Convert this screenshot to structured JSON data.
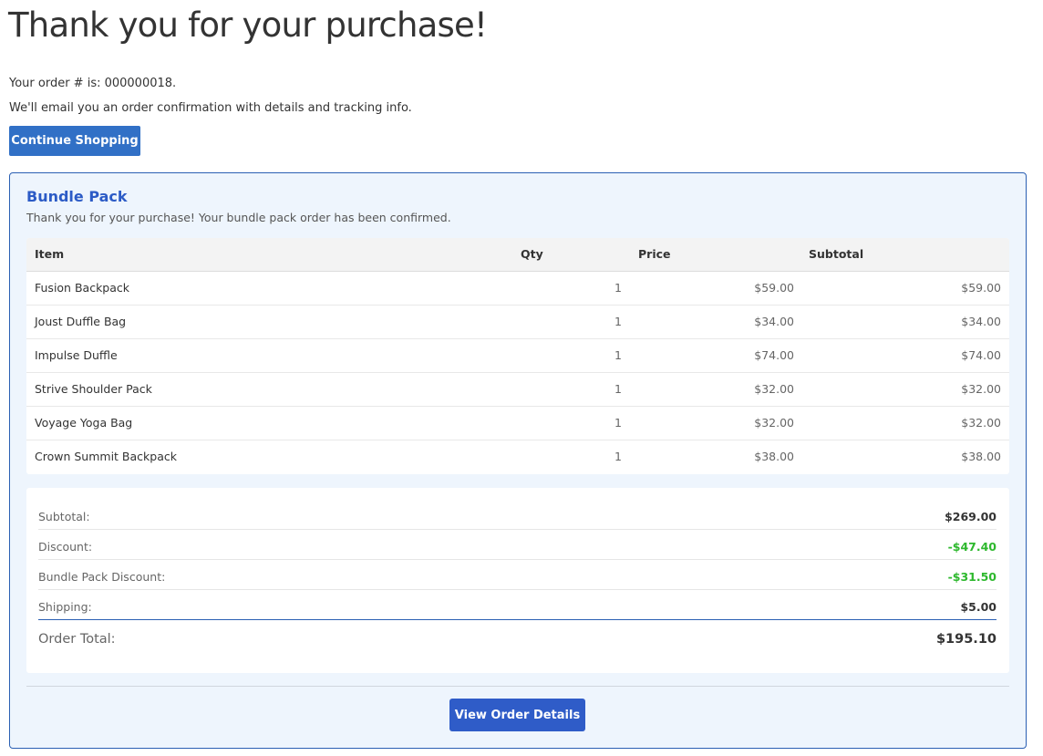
{
  "page": {
    "title": "Thank you for your purchase!",
    "order_line": "Your order # is: 000000018.",
    "email_line": "We'll email you an order confirmation with details and tracking info.",
    "continue_label": "Continue Shopping"
  },
  "bundle": {
    "title": "Bundle Pack",
    "subtitle": "Thank you for your purchase! Your bundle pack order has been confirmed.",
    "columns": [
      "Item",
      "Qty",
      "Price",
      "Subtotal"
    ],
    "items": [
      {
        "name": "Fusion Backpack",
        "qty": "1",
        "price": "$59.00",
        "subtotal": "$59.00"
      },
      {
        "name": "Joust Duffle Bag",
        "qty": "1",
        "price": "$34.00",
        "subtotal": "$34.00"
      },
      {
        "name": "Impulse Duffle",
        "qty": "1",
        "price": "$74.00",
        "subtotal": "$74.00"
      },
      {
        "name": "Strive Shoulder Pack",
        "qty": "1",
        "price": "$32.00",
        "subtotal": "$32.00"
      },
      {
        "name": "Voyage Yoga Bag",
        "qty": "1",
        "price": "$32.00",
        "subtotal": "$32.00"
      },
      {
        "name": "Crown Summit Backpack",
        "qty": "1",
        "price": "$38.00",
        "subtotal": "$38.00"
      }
    ],
    "totals": [
      {
        "label": "Subtotal:",
        "value": "$269.00"
      },
      {
        "label": "Discount:",
        "value": "-$47.40"
      },
      {
        "label": "Bundle Pack Discount:",
        "value": "-$31.50"
      },
      {
        "label": "Shipping:",
        "value": "$5.00"
      }
    ],
    "order_total": {
      "label": "Order Total:",
      "value": "$195.10"
    },
    "view_label": "View Order Details"
  },
  "colors": {
    "primary_button": "#3170c6",
    "bundle_title": "#2c5bc6",
    "discount_green": "#2db82d",
    "bundle_bg": "#eef5fd",
    "bundle_border": "#2a5fb3"
  }
}
